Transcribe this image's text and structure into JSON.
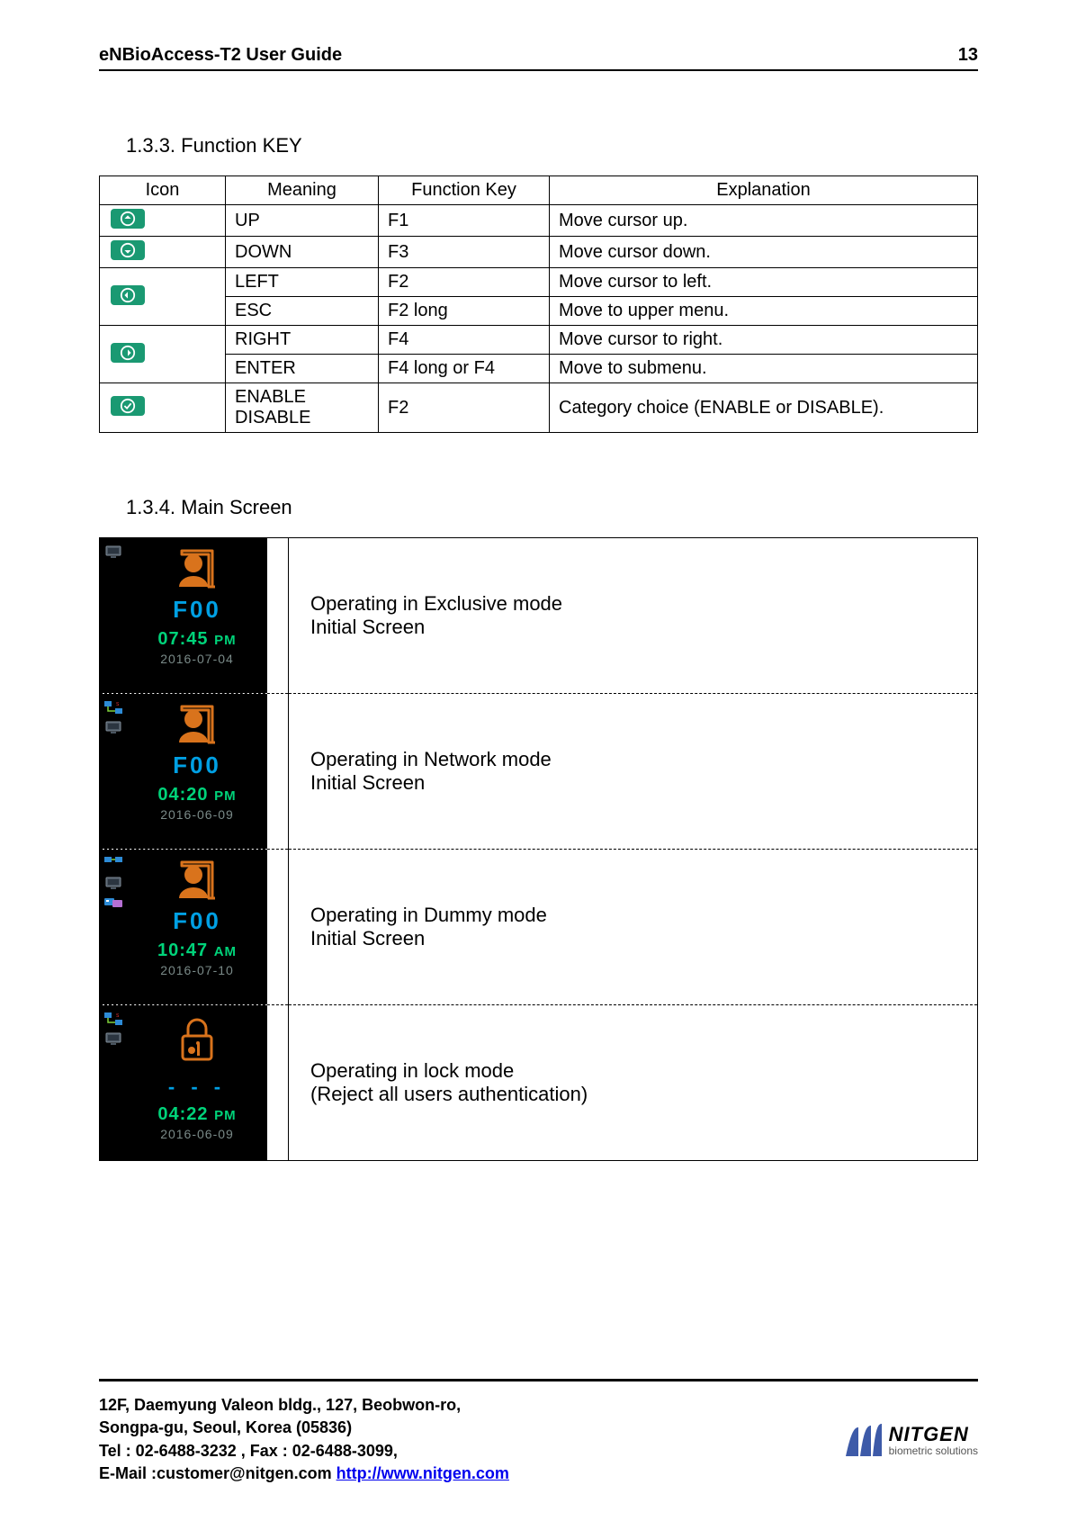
{
  "header": {
    "title": "eNBioAccess-T2 User Guide",
    "page": "13"
  },
  "sections": {
    "function_key": {
      "heading": "1.3.3. Function KEY",
      "columns": [
        "Icon",
        "Meaning",
        "Function Key",
        "Explanation"
      ],
      "rows": [
        {
          "icon": "arrow-up-icon",
          "meaning": "UP",
          "key": "F1",
          "explanation": "Move cursor up."
        },
        {
          "icon": "arrow-down-icon",
          "meaning": "DOWN",
          "key": "F3",
          "explanation": "Move cursor down."
        },
        {
          "icon": "arrow-left-icon",
          "meaning": "LEFT",
          "key": "F2",
          "explanation": "Move cursor to left."
        },
        {
          "icon": "arrow-left-icon",
          "meaning": "ESC",
          "key": "F2 long",
          "explanation": "Move to upper menu."
        },
        {
          "icon": "arrow-right-icon",
          "meaning": "RIGHT",
          "key": "F4",
          "explanation": "Move cursor to right."
        },
        {
          "icon": "arrow-right-icon",
          "meaning": "ENTER",
          "key": "F4 long or F4",
          "explanation": "Move to submenu."
        },
        {
          "icon": "check-circle-icon",
          "meaning": "ENABLE\nDISABLE",
          "key": "F2",
          "explanation": "Category choice (ENABLE or DISABLE)."
        }
      ]
    },
    "main_screen": {
      "heading": "1.3.4. Main Screen",
      "rows": [
        {
          "screen": {
            "status_icons": [
              "terminal"
            ],
            "mode_code": "F00",
            "time": "07:45",
            "ampm": "PM",
            "date": "2016-07-04",
            "lock": false
          },
          "desc": "Operating in Exclusive mode\nInitial Screen"
        },
        {
          "screen": {
            "status_icons": [
              "network",
              "terminal"
            ],
            "mode_code": "F00",
            "time": "04:20",
            "ampm": "PM",
            "date": "2016-06-09",
            "lock": false
          },
          "desc": "Operating in Network mode\nInitial Screen"
        },
        {
          "screen": {
            "status_icons": [
              "network-alt",
              "terminal",
              "card"
            ],
            "mode_code": "F00",
            "time": "10:47",
            "ampm": "AM",
            "date": "2016-07-10",
            "lock": false
          },
          "desc": "Operating in Dummy mode\nInitial Screen"
        },
        {
          "screen": {
            "status_icons": [
              "network",
              "terminal"
            ],
            "mode_code": "",
            "time": "04:22",
            "ampm": "PM",
            "date": "2016-06-09",
            "lock": true
          },
          "desc": "Operating in lock mode\n(Reject all users authentication)"
        }
      ]
    }
  },
  "footer": {
    "line1": "12F, Daemyung Valeon bldg., 127, Beobwon-ro,",
    "line2": "Songpa-gu, Seoul, Korea (05836)",
    "line3": "Tel : 02-6488-3232 , Fax : 02-6488-3099,",
    "email_prefix": "E-Mail :customer@nitgen.com ",
    "url": "http://www.nitgen.com",
    "logo_name": "NITGEN",
    "logo_sub": "biometric solutions"
  }
}
